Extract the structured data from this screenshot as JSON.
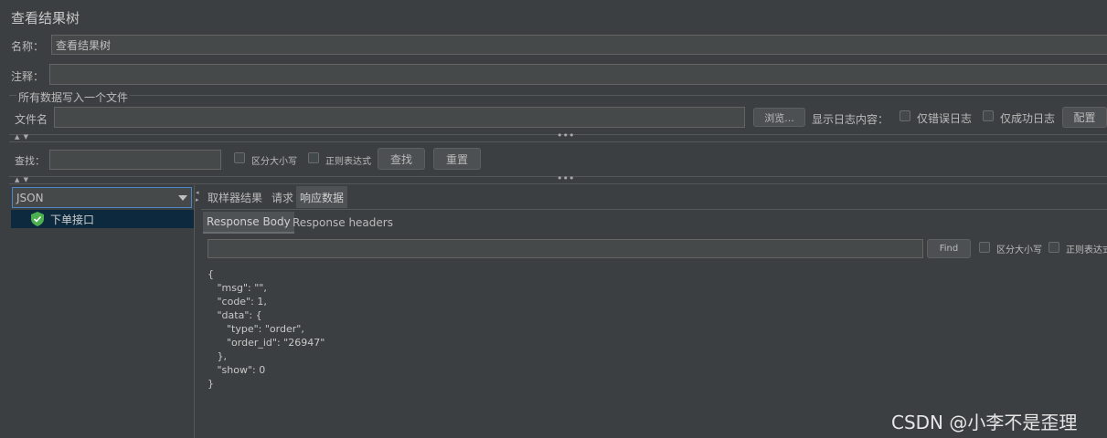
{
  "window": {
    "title": "查看结果树"
  },
  "name_row": {
    "label": "名称：",
    "value": "查看结果树"
  },
  "comment_row": {
    "label": "注释：",
    "value": ""
  },
  "file_section": {
    "title": "所有数据写入一个文件",
    "filename_label": "文件名",
    "filename_value": "",
    "browse_label": "浏览...",
    "log_content_label": "显示日志内容：",
    "errors_only_label": "仅错误日志",
    "success_only_label": "仅成功日志",
    "configure_label": "配置"
  },
  "search_bar": {
    "label": "查找：",
    "value": "",
    "case_label": "区分大小写",
    "regex_label": "正则表达式",
    "find_label": "查找",
    "reset_label": "重置"
  },
  "left_panel": {
    "renderer_selected": "JSON",
    "tree_items": [
      {
        "label": "下单接口",
        "status": "success"
      }
    ]
  },
  "right_panel": {
    "tabs": [
      "取样器结果",
      "请求",
      "响应数据"
    ],
    "active_tab": "响应数据",
    "subtabs": [
      "Response Body",
      "Response headers"
    ],
    "active_subtab": "Response Body",
    "find_button_label": "Find",
    "case_label": "区分大小写",
    "regex_label": "正则表达式",
    "response_lines": [
      "{",
      "   \"msg\": \"\",",
      "   \"code\": 1,",
      "   \"data\": {",
      "      \"type\": \"order\",",
      "      \"order_id\": \"26947\"",
      "   },",
      "   \"show\": 0",
      "}"
    ]
  },
  "watermark": "CSDN @小李不是歪理",
  "colors": {
    "background": "#3c3f41",
    "field": "#45494a",
    "selection": "#0d293e",
    "success": "#4caf50"
  },
  "icons": {
    "tree_status": "check-shield-icon",
    "dropdown": "chevron-down-icon"
  }
}
